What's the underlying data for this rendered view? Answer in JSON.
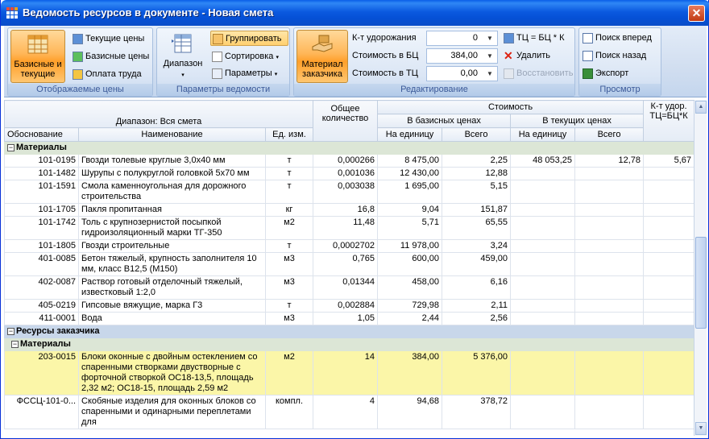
{
  "window": {
    "title": "Ведомость ресурсов в документе - Новая смета",
    "close": "✕"
  },
  "ribbon": {
    "group_display": {
      "caption": "Отображаемые цены",
      "big_button": "Базисные и текущие",
      "options": [
        {
          "label": "Текущие цены",
          "color": "#5b8fd6"
        },
        {
          "label": "Базисные цены",
          "color": "#5cbf5c"
        },
        {
          "label": "Оплата труда",
          "color": "#f4c542"
        }
      ]
    },
    "group_params": {
      "caption": "Параметры ведомости",
      "range_button": "Диапазон",
      "group_button": "Группировать",
      "sort_button": "Сортировка",
      "params_button": "Параметры"
    },
    "group_edit": {
      "caption": "Редактирование",
      "material_button": "Материал заказчика",
      "fields": [
        {
          "label": "К-т удорожания",
          "value": "0"
        },
        {
          "label": "Стоимость в БЦ",
          "value": "384,00"
        },
        {
          "label": "Стоимость в ТЦ",
          "value": "0,00"
        }
      ],
      "formula_button": "ТЦ = БЦ * К",
      "delete_button": "Удалить",
      "restore_button": "Восстановить"
    },
    "group_view": {
      "caption": "Просмотр",
      "search_forward": "Поиск вперед",
      "search_back": "Поиск назад",
      "export": "Экспорт"
    }
  },
  "table": {
    "headers": {
      "range": "Диапазон: Вся смета",
      "basis": "Обоснование",
      "name": "Наименование",
      "unit": "Ед. изм.",
      "qty": "Общее количество",
      "cost": "Стоимость",
      "base_prices": "В базисных ценах",
      "current_prices": "В текущих ценах",
      "per_unit": "На единицу",
      "total": "Всего",
      "coef": "К-т удор. ТЦ=БЦ*К"
    },
    "group_materials": "Материалы",
    "rows": [
      {
        "basis": "101-0195",
        "name": "Гвозди толевые круглые 3,0х40 мм",
        "unit": "т",
        "qty": "0,000266",
        "bunit": "8 475,00",
        "btotal": "2,25",
        "cunit": "48 053,25",
        "ctotal": "12,78",
        "coef": "5,67"
      },
      {
        "basis": "101-1482",
        "name": "Шурупы с полукруглой головкой 5х70 мм",
        "unit": "т",
        "qty": "0,001036",
        "bunit": "12 430,00",
        "btotal": "12,88",
        "cunit": "",
        "ctotal": "",
        "coef": ""
      },
      {
        "basis": "101-1591",
        "name": "Смола каменноугольная для дорожного строительства",
        "unit": "т",
        "qty": "0,003038",
        "bunit": "1 695,00",
        "btotal": "5,15",
        "cunit": "",
        "ctotal": "",
        "coef": ""
      },
      {
        "basis": "101-1705",
        "name": "Пакля пропитанная",
        "unit": "кг",
        "qty": "16,8",
        "bunit": "9,04",
        "btotal": "151,87",
        "cunit": "",
        "ctotal": "",
        "coef": ""
      },
      {
        "basis": "101-1742",
        "name": "Толь с крупнозернистой посыпкой гидроизоляционный марки ТГ-350",
        "unit": "м2",
        "qty": "11,48",
        "bunit": "5,71",
        "btotal": "65,55",
        "cunit": "",
        "ctotal": "",
        "coef": ""
      },
      {
        "basis": "101-1805",
        "name": "Гвозди строительные",
        "unit": "т",
        "qty": "0,0002702",
        "bunit": "11 978,00",
        "btotal": "3,24",
        "cunit": "",
        "ctotal": "",
        "coef": ""
      },
      {
        "basis": "401-0085",
        "name": "Бетон тяжелый, крупность заполнителя 10 мм, класс В12,5 (М150)",
        "unit": "м3",
        "qty": "0,765",
        "bunit": "600,00",
        "btotal": "459,00",
        "cunit": "",
        "ctotal": "",
        "coef": ""
      },
      {
        "basis": "402-0087",
        "name": "Раствор готовый отделочный тяжелый, известковый 1:2,0",
        "unit": "м3",
        "qty": "0,01344",
        "bunit": "458,00",
        "btotal": "6,16",
        "cunit": "",
        "ctotal": "",
        "coef": ""
      },
      {
        "basis": "405-0219",
        "name": "Гипсовые вяжущие, марка Г3",
        "unit": "т",
        "qty": "0,002884",
        "bunit": "729,98",
        "btotal": "2,11",
        "cunit": "",
        "ctotal": "",
        "coef": ""
      },
      {
        "basis": "411-0001",
        "name": "Вода",
        "unit": "м3",
        "qty": "1,05",
        "bunit": "2,44",
        "btotal": "2,56",
        "cunit": "",
        "ctotal": "",
        "coef": ""
      }
    ],
    "group_customer": "Ресурсы заказчика",
    "group_customer_materials": "Материалы",
    "customer_rows": [
      {
        "basis": "203-0015",
        "name": "Блоки оконные с двойным остеклением со спаренными створками двустворные с форточной створкой ОС18-13,5, площадь 2,32 м2; ОС18-15, площадь 2,59 м2",
        "unit": "м2",
        "qty": "14",
        "bunit": "384,00",
        "btotal": "5 376,00",
        "cunit": "",
        "ctotal": "",
        "coef": ""
      },
      {
        "basis": "ФССЦ-101-0...",
        "name": "Скобяные изделия для оконных блоков со спаренными и одинарными переплетами для",
        "unit": "компл.",
        "qty": "4",
        "bunit": "94,68",
        "btotal": "378,72",
        "cunit": "",
        "ctotal": "",
        "coef": ""
      }
    ]
  }
}
